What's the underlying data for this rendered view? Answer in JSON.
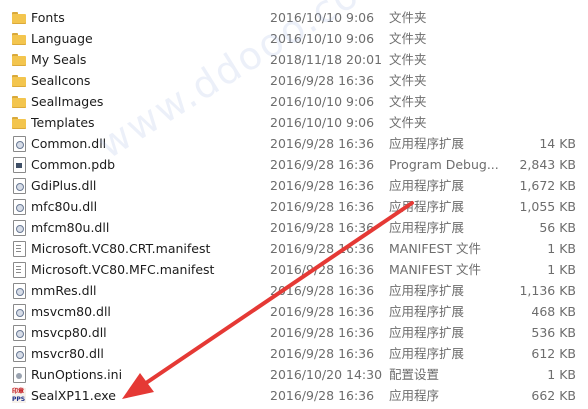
{
  "rows": [
    {
      "icon": "folder-icon",
      "name": "Fonts",
      "date": "2016/10/10 9:06",
      "type": "文件夹",
      "size": ""
    },
    {
      "icon": "folder-icon",
      "name": "Language",
      "date": "2016/10/10 9:06",
      "type": "文件夹",
      "size": ""
    },
    {
      "icon": "folder-icon",
      "name": "My Seals",
      "date": "2018/11/18 20:01",
      "type": "文件夹",
      "size": ""
    },
    {
      "icon": "folder-icon",
      "name": "SealIcons",
      "date": "2016/9/28 16:36",
      "type": "文件夹",
      "size": ""
    },
    {
      "icon": "folder-icon",
      "name": "SealImages",
      "date": "2016/10/10 9:06",
      "type": "文件夹",
      "size": ""
    },
    {
      "icon": "folder-icon",
      "name": "Templates",
      "date": "2016/10/10 9:06",
      "type": "文件夹",
      "size": ""
    },
    {
      "icon": "dll-file-icon",
      "name": "Common.dll",
      "date": "2016/9/28 16:36",
      "type": "应用程序扩展",
      "size": "14 KB"
    },
    {
      "icon": "pdb-file-icon",
      "name": "Common.pdb",
      "date": "2016/9/28 16:36",
      "type": "Program Debug...",
      "size": "2,843 KB"
    },
    {
      "icon": "dll-file-icon",
      "name": "GdiPlus.dll",
      "date": "2016/9/28 16:36",
      "type": "应用程序扩展",
      "size": "1,672 KB"
    },
    {
      "icon": "dll-file-icon",
      "name": "mfc80u.dll",
      "date": "2016/9/28 16:36",
      "type": "应用程序扩展",
      "size": "1,055 KB"
    },
    {
      "icon": "dll-file-icon",
      "name": "mfcm80u.dll",
      "date": "2016/9/28 16:36",
      "type": "应用程序扩展",
      "size": "56 KB"
    },
    {
      "icon": "manifest-file-icon",
      "name": "Microsoft.VC80.CRT.manifest",
      "date": "2016/9/28 16:36",
      "type": "MANIFEST 文件",
      "size": "1 KB"
    },
    {
      "icon": "manifest-file-icon",
      "name": "Microsoft.VC80.MFC.manifest",
      "date": "2016/9/28 16:36",
      "type": "MANIFEST 文件",
      "size": "1 KB"
    },
    {
      "icon": "dll-file-icon",
      "name": "mmRes.dll",
      "date": "2016/9/28 16:36",
      "type": "应用程序扩展",
      "size": "1,136 KB"
    },
    {
      "icon": "dll-file-icon",
      "name": "msvcm80.dll",
      "date": "2016/9/28 16:36",
      "type": "应用程序扩展",
      "size": "468 KB"
    },
    {
      "icon": "dll-file-icon",
      "name": "msvcp80.dll",
      "date": "2016/9/28 16:36",
      "type": "应用程序扩展",
      "size": "536 KB"
    },
    {
      "icon": "dll-file-icon",
      "name": "msvcr80.dll",
      "date": "2016/9/28 16:36",
      "type": "应用程序扩展",
      "size": "612 KB"
    },
    {
      "icon": "ini-file-icon",
      "name": "RunOptions.ini",
      "date": "2016/10/20 14:30",
      "type": "配置设置",
      "size": "1 KB"
    },
    {
      "icon": "seal-app-icon",
      "name": "SealXP11.exe",
      "date": "2016/9/28 16:36",
      "type": "应用程序",
      "size": "662 KB"
    }
  ],
  "exe_icon": {
    "top_text": "印章",
    "bottom_text": "PPS"
  },
  "watermark": "www.ddooo.com",
  "colors": {
    "arrow": "#e53935",
    "folder": "#f3c54e"
  }
}
